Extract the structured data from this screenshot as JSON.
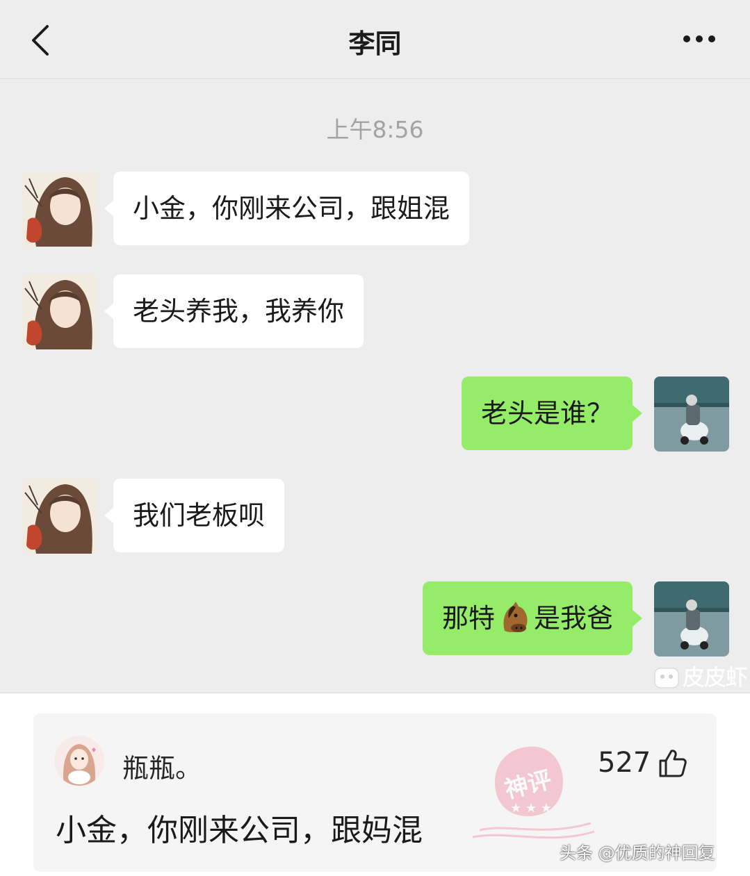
{
  "header": {
    "title": "李同",
    "back_icon": "chevron-left-icon",
    "more_icon": "ellipsis-icon"
  },
  "chat": {
    "timestamp": "上午8:56",
    "messages": [
      {
        "side": "in",
        "text": "小金，你刚来公司，跟姐混"
      },
      {
        "side": "in",
        "text": "老头养我，我养你"
      },
      {
        "side": "out",
        "text": "老头是谁？"
      },
      {
        "side": "in",
        "text": "我们老板呗"
      },
      {
        "side": "out",
        "text_before": "那特",
        "emoji": "horse-face-icon",
        "text_after": "是我爸"
      }
    ],
    "watermark": "皮皮虾"
  },
  "comment": {
    "username": "瓶瓶。",
    "likes": "527",
    "text": "小金，你刚来公司，跟妈混",
    "stamp_text": "神评",
    "source": "头条 @优质的神回复"
  },
  "colors": {
    "background": "#ededed",
    "outgoing_bubble": "#95ec69",
    "incoming_bubble": "#ffffff",
    "stamp": "#f3a3b6"
  }
}
